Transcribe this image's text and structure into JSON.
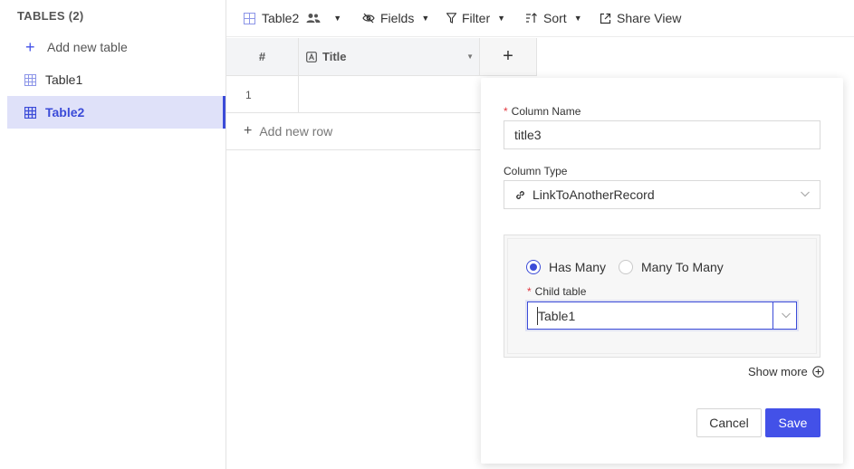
{
  "sidebar": {
    "header": "TABLES (2)",
    "add_label": "Add new table",
    "tables": [
      "Table1",
      "Table2"
    ]
  },
  "toolbar": {
    "table_name": "Table2",
    "fields": "Fields",
    "filter": "Filter",
    "sort": "Sort",
    "share": "Share View"
  },
  "grid": {
    "num_header": "#",
    "title_header": "Title",
    "plus": "+",
    "row_number": "1",
    "add_row": "Add new row"
  },
  "panel": {
    "column_name_label": "Column Name",
    "column_name_value": "title3",
    "column_type_label": "Column Type",
    "column_type_value": "LinkToAnotherRecord",
    "relation_has_many": "Has Many",
    "relation_many_to_many": "Many To Many",
    "child_table_label": "Child table",
    "child_table_value": "Table1",
    "show_more": "Show more",
    "cancel": "Cancel",
    "save": "Save"
  },
  "colors": {
    "accent": "#4351e8",
    "active_bg": "#dfe1f9",
    "required": "#e2373f"
  }
}
